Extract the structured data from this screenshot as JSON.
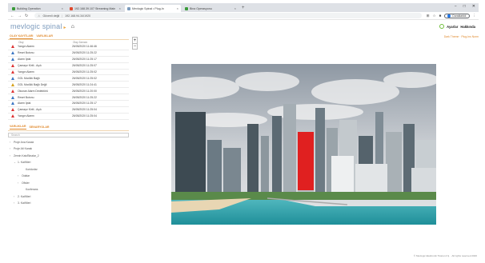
{
  "browser": {
    "tabs": [
      {
        "label": "Building Operation",
        "color": "#3a9b3a",
        "active": false
      },
      {
        "label": "192.168.39.107 Streaming Main",
        "color": "#e0482c",
        "active": false
      },
      {
        "label": "Mevlogic Spinal • Plug-In",
        "color": "#7c9bbd",
        "active": true
      },
      {
        "label": "Bina Operasyonu",
        "color": "#3a9b3a",
        "active": false
      }
    ],
    "url": "192.168.94.34/1920",
    "security_label": "Güvenli değil",
    "profile_label": "Duraklatıldı"
  },
  "app": {
    "logo": "mevlogic spinal",
    "user_labels": [
      "Ayarlar",
      "Hakkında"
    ],
    "view_links": "Dark Theme · Plug-Ins Norm"
  },
  "alarm_panel": {
    "tabs": [
      "OLAY KAYITLARI",
      "VARLIKLAR"
    ],
    "columns": [
      "Olay",
      "Olay Zamanı"
    ],
    "rows": [
      {
        "name": "Yangın Alarmı",
        "time": "26/05/2020 11:46:46",
        "severity": "red"
      },
      {
        "name": "Reset Butonu",
        "time": "26/05/2020 11:25:22",
        "severity": "blue"
      },
      {
        "name": "Alarm İptal",
        "time": "26/05/2020 11:25:17",
        "severity": "blue"
      },
      {
        "name": "Çamaşır Kiriti - Açık",
        "time": "26/05/2020 11:25:07",
        "severity": "red"
      },
      {
        "name": "Yangın Alarmı",
        "time": "26/05/2020 11:25:02",
        "severity": "red"
      },
      {
        "name": "GOL Modülü Bağlı",
        "time": "26/05/2020 11:25:02",
        "severity": "blue"
      },
      {
        "name": "GOL Modülü Bağlı Değil",
        "time": "26/05/2020 11:24:41",
        "severity": "yellow"
      },
      {
        "name": "Okunan Alarm Dedektörü",
        "time": "26/05/2020 11:20:00",
        "severity": "red"
      },
      {
        "name": "Reset Butonu",
        "time": "26/05/2020 11:25:22",
        "severity": "blue"
      },
      {
        "name": "Alarm İptal",
        "time": "26/05/2020 11:25:17",
        "severity": "blue"
      },
      {
        "name": "Çamaşır Kiriti - Açık",
        "time": "26/05/2020 11:25:04",
        "severity": "red"
      },
      {
        "name": "Yangın Alarmı",
        "time": "26/05/2020 11:25:04",
        "severity": "red"
      }
    ]
  },
  "tree_panel": {
    "tabs": [
      "VARLIKLAR",
      "SENARYOLAR"
    ],
    "search_placeholder": "Search",
    "items": [
      {
        "label": "Proje Ana Kanalı",
        "caret": "›",
        "indent": 0
      },
      {
        "label": "Proje Alt Kanalı",
        "caret": "›",
        "indent": 0
      },
      {
        "label": "Zemin Katı/Binalar_2",
        "caret": "›",
        "indent": 0
      },
      {
        "label": "1. Kat/Meri",
        "caret": "⌄",
        "indent": 1
      },
      {
        "label": "Koridorlar",
        "caret": "",
        "indent": 3
      },
      {
        "label": "Odalar",
        "caret": "›",
        "indent": 2
      },
      {
        "label": "Ofisler",
        "caret": "›",
        "indent": 2
      },
      {
        "label": "Konferans",
        "caret": "",
        "indent": 3
      },
      {
        "label": "2. Kat/Meri",
        "caret": "›",
        "indent": 1
      },
      {
        "label": "3. Kat/Meri",
        "caret": "›",
        "indent": 1
      }
    ]
  },
  "zoom": {
    "in": "+",
    "out": "−"
  },
  "footer": "© Mevlogic Elektronik Ticaret A.Ş. · All rights reserved 2020"
}
